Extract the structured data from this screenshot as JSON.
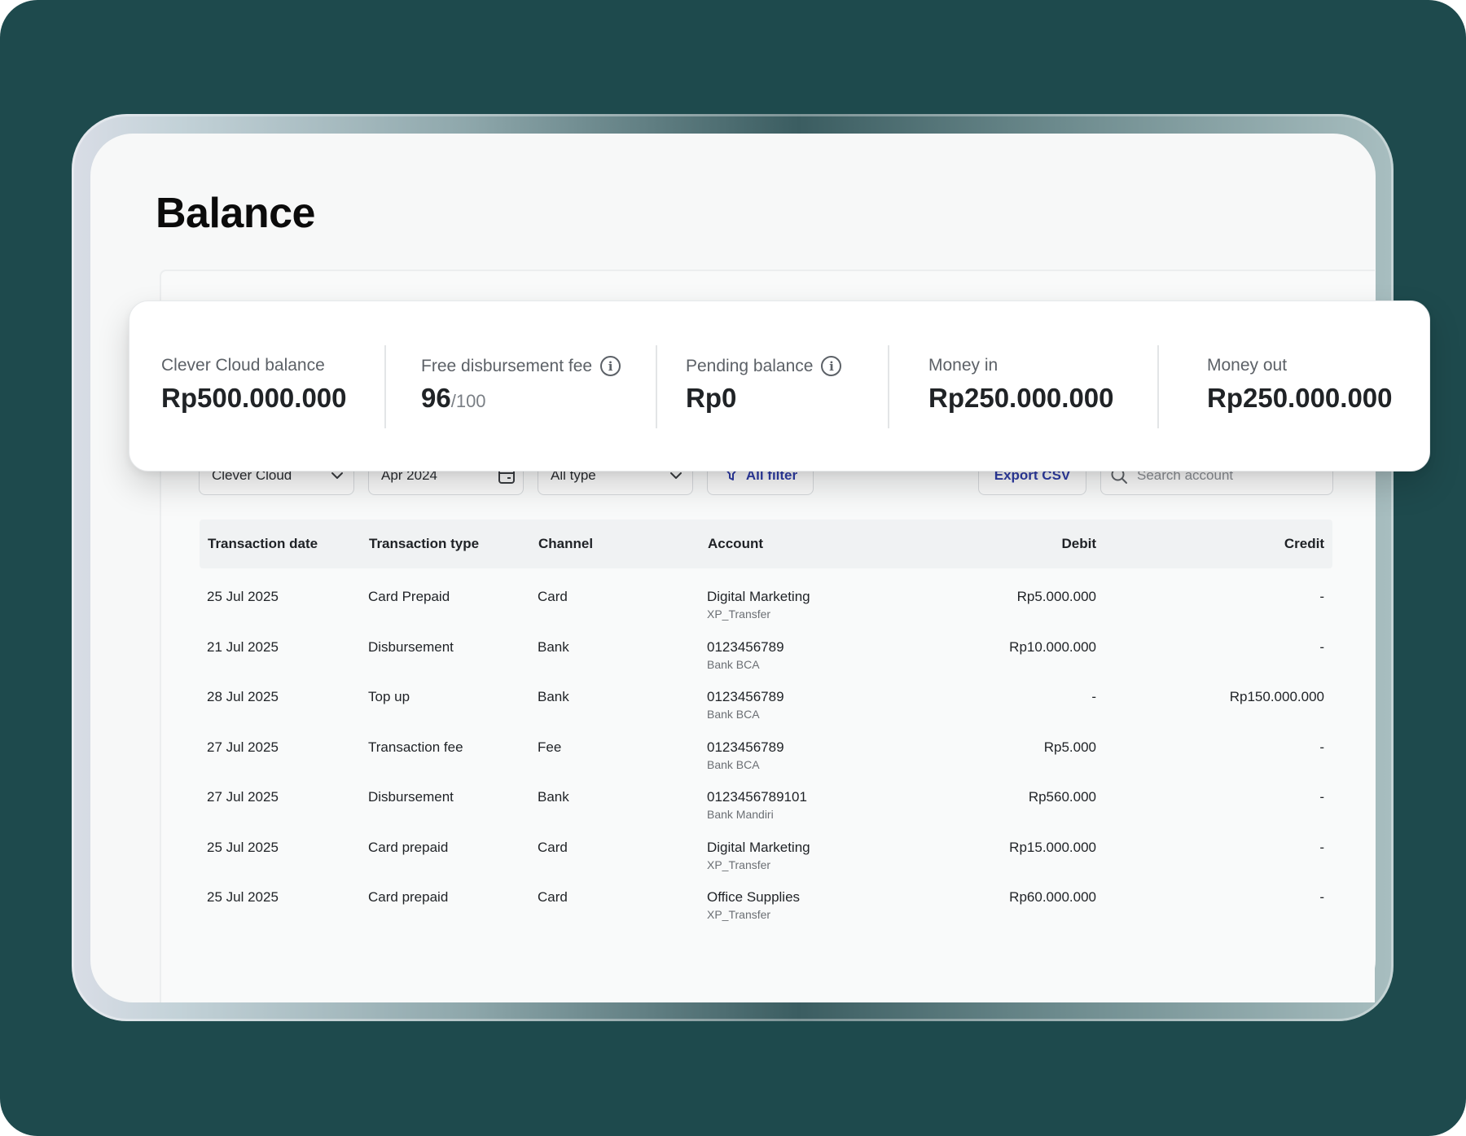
{
  "page": {
    "title": "Balance"
  },
  "summary": {
    "clever_cloud_balance": {
      "label": "Clever Cloud balance",
      "value": "Rp500.000.000"
    },
    "free_disbursement_fee": {
      "label": "Free disbursement fee",
      "value": "96",
      "total": "/100",
      "icon": "info-icon"
    },
    "pending_balance": {
      "label": "Pending balance",
      "value": "Rp0",
      "icon": "info-icon"
    },
    "money_in": {
      "label": "Money in",
      "value": "Rp250.000.000"
    },
    "money_out": {
      "label": "Money out",
      "value": "Rp250.000.000"
    }
  },
  "toolbar": {
    "account_select": "Clever Cloud",
    "date_picker": "Apr 2024",
    "type_select": "All type",
    "filter_label": "All filter",
    "export_label": "Export CSV",
    "search_placeholder": "Search account"
  },
  "table": {
    "headers": [
      "Transaction date",
      "Transaction type",
      "Channel",
      "Account",
      "Debit",
      "Credit"
    ],
    "rows": [
      {
        "date": "25 Jul 2025",
        "type": "Card Prepaid",
        "channel": "Card",
        "account": "Digital Marketing",
        "account_sub": "XP_Transfer",
        "debit": "Rp5.000.000",
        "credit": "-"
      },
      {
        "date": "21 Jul 2025",
        "type": "Disbursement",
        "channel": "Bank",
        "account": "0123456789",
        "account_sub": "Bank BCA",
        "debit": "Rp10.000.000",
        "credit": "-"
      },
      {
        "date": "28 Jul 2025",
        "type": "Top up",
        "channel": "Bank",
        "account": "0123456789",
        "account_sub": "Bank BCA",
        "debit": "-",
        "credit": "Rp150.000.000"
      },
      {
        "date": "27 Jul 2025",
        "type": "Transaction fee",
        "channel": "Fee",
        "account": "0123456789",
        "account_sub": "Bank BCA",
        "debit": "Rp5.000",
        "credit": "-"
      },
      {
        "date": "27 Jul 2025",
        "type": "Disbursement",
        "channel": "Bank",
        "account": "0123456789101",
        "account_sub": "Bank Mandiri",
        "debit": "Rp560.000",
        "credit": "-"
      },
      {
        "date": "25 Jul 2025",
        "type": "Card prepaid",
        "channel": "Card",
        "account": "Digital Marketing",
        "account_sub": "XP_Transfer",
        "debit": "Rp15.000.000",
        "credit": "-"
      },
      {
        "date": "25 Jul 2025",
        "type": "Card prepaid",
        "channel": "Card",
        "account": "Office Supplies",
        "account_sub": "XP_Transfer",
        "debit": "Rp60.000.000",
        "credit": "-"
      }
    ]
  },
  "colors": {
    "background": "#1e4a4d",
    "accent": "#2f3da6",
    "surface": "#f7f8f8"
  }
}
